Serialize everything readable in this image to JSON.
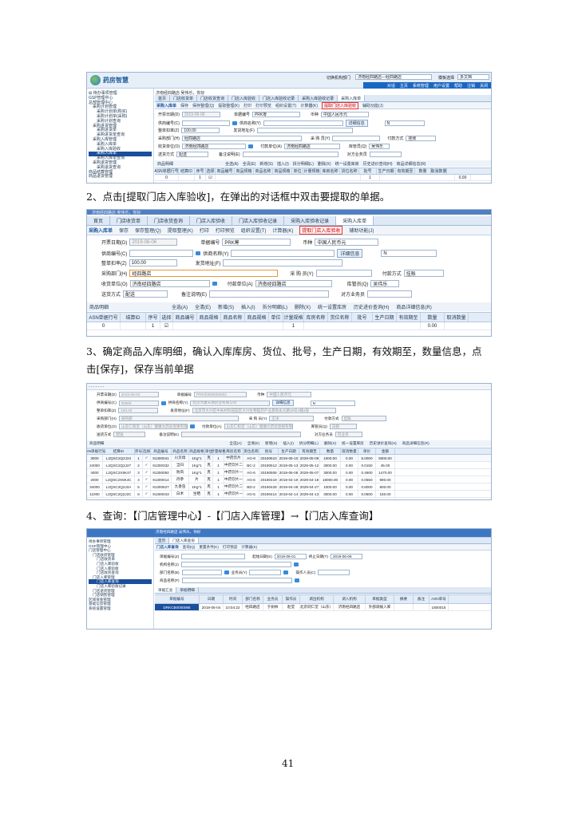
{
  "page_number": "41",
  "steps": {
    "step2": "2、点击[提取门店入库验收]，在弹出的对话框中双击要提取的单据。",
    "step3_line1": "3、确定商品入库明细，确认入库库房、货位、批号，生产日期，有效期至，数量信息，点",
    "step3_line2": "击[保存]，保存当前单据",
    "step4": "4、查询：【门店管理中心】-【门店入库管理】→【门店入库查询】"
  },
  "shot1": {
    "logo": "药房智慧",
    "user_line": "济南经四路店  吴伟乐，你好",
    "top_right": [
      "切换机构部门",
      "济南经四路店—经四路店",
      "模板选择",
      "多文档"
    ],
    "blue_nav": [
      "对话",
      "主页",
      "系统管理",
      "用户设置",
      "帮助",
      "注销",
      "关闭"
    ],
    "tabs": [
      "首页",
      "门店收货单",
      "门店收货查询",
      "门店入库验收",
      "门店入库验收记录",
      "采购入库验收记录",
      "采购入库单"
    ],
    "toolbar": [
      "采购入库单",
      "保存",
      "保存整理(Q)",
      "提取整理(K)",
      "打印",
      "打印预览",
      "组织设置(T)",
      "计算器(K)",
      "提取门店入库验收",
      "辅助功能(J)"
    ],
    "sidebar": [
      "待办事项管理",
      "GSP管理中心",
      "总部管理中心",
      "采购计划管理",
      "采购计划单(购买)",
      "采购计划单(采购)",
      "采购计划查询",
      "采购进货管理",
      "采购进货单",
      "采购进货单查询",
      "采购入库管理",
      "采购入库单",
      "采购入库验收",
      "采购入库单",
      "采购入库单查询",
      "采购退货管理",
      "采购退货查询",
      "商品结算管理",
      "商品退货管理"
    ],
    "form": {
      "open_date_label": "开票日期(D)",
      "open_date": "2019-06-06",
      "doc_no_label": "单据编号",
      "doc_no": "PRK筹",
      "currency_label": "币种",
      "currency": "中国人民币元",
      "supplier_no_label": "供商编号(C)",
      "supplier_name_label": "供商名称(Y)",
      "detail_btn": "详细信息",
      "n_field": "N",
      "discount_label": "整单扣率(Z)",
      "discount": "100.00",
      "ship_addr_label": "发货地址(F)",
      "buyer_dept_label": "采购部门(H)",
      "buyer_dept": "经四路店",
      "buyer_label": "采 购 员(Y)",
      "pay_label": "付款方式",
      "pay": "挂账",
      "recv_unit_label": "收货单位(O)",
      "recv_unit": "济南经四路店",
      "pay_unit_label": "付款单位(A)",
      "pay_unit": "济南经四路店",
      "warehouse_keeper_label": "库管员(Q)",
      "warehouse_keeper": "吴伟乐",
      "delivery_label": "送货方式",
      "delivery": "配送",
      "remark_label": "备注说明(E)",
      "salesman_label": "对方业务员"
    },
    "grid_tools": [
      "商品明细",
      "全选(A)",
      "全清(E)",
      "新增(S)",
      "插入(I)",
      "拆分明细(L)",
      "删除(X)",
      "统一设置库房",
      "历史进价查询(H)",
      "商品详细信息(R)"
    ],
    "grid_cols": [
      "ASN单据行号",
      "结算ID",
      "序号",
      "选择",
      "商品编号",
      "商品规格",
      "商品名称",
      "商品规格",
      "单位",
      "计量规格",
      "库房名称",
      "货位名称",
      "批号",
      "生产日期",
      "有效期至",
      "数量",
      "取消数量"
    ],
    "grid_row": {
      "asn": "0",
      "seq": "1",
      "spec": "1",
      "qty": "0.00"
    }
  },
  "shot2": {
    "user_line": "济南经四路店  吴伟乐，你好",
    "tabs": [
      "首页",
      "门店收货单",
      "门店收货查询",
      "门店入库验收",
      "门店入库验收记录",
      "采购入库验收记录",
      "采购入库单"
    ],
    "toolbar": [
      "采购入库单",
      "保存",
      "保存整理(Q)",
      "提取整理(K)",
      "打印",
      "打印预览",
      "组织设置(T)",
      "计算器(K)",
      "提取门店入库验收",
      "辅助功能(J)"
    ],
    "form": {
      "open_date_label": "开票日期(D)",
      "open_date": "2019-06-06",
      "doc_no_label": "单据编号",
      "doc_no": "PRK筹",
      "currency_label": "币种",
      "currency": "中国人民币元",
      "supplier_no_label": "供商编号(C)",
      "supplier_name_label": "供商名称(Y)",
      "detail_btn": "详细信息",
      "n_field": "N",
      "discount_label": "整单扣率(Z)",
      "discount": "100.00",
      "ship_addr_label": "发货地址(F)",
      "buyer_dept_label": "采购部门(H)",
      "buyer_dept": "经四路店",
      "buyer_label": "采 购 员(Y)",
      "pay_label": "付款方式",
      "pay": "挂账",
      "recv_unit_label": "收货单位(O)",
      "recv_unit": "济南经四路店",
      "pay_unit_label": "付款单位(A)",
      "pay_unit": "济南经四路店",
      "warehouse_keeper_label": "库管员(Q)",
      "warehouse_keeper": "吴伟乐",
      "delivery_label": "送货方式",
      "delivery": "配送",
      "remark_label": "备注说明(E)",
      "salesman_label": "对方业务员"
    },
    "grid_tools": [
      "商品明细",
      "全选(A)",
      "全清(E)",
      "新增(S)",
      "插入(I)",
      "拆分明细(L)",
      "删除(X)",
      "统一设置库房",
      "历史进价查询(H)",
      "商品详细信息(R)"
    ],
    "grid_cols": [
      "ASN单据行号",
      "结算ID",
      "序号",
      "选择",
      "商品编号",
      "商品规格",
      "商品名称",
      "商品规格",
      "单位",
      "计量规格",
      "库房名称",
      "货位名称",
      "批号",
      "生产日期",
      "有效期至",
      "数量",
      "取消数量"
    ],
    "grid_row": {
      "asn": "0",
      "seq": "1",
      "spec": "1",
      "qty": "0.00"
    }
  },
  "shot3": {
    "form": {
      "open_date_label": "开票日期(D)",
      "open_date": "2019-06-04",
      "doc_no_label": "单据编号",
      "doc_no": "PRK00000000003",
      "currency_label": "币种",
      "currency": "中国人民币元",
      "supplier_no_label": "供商编号(C)",
      "supplier_no": "00009",
      "supplier_name_label": "供商名称(Y)",
      "supplier_name": "北京大康天源药业有限公司",
      "detail_btn": "详细信息",
      "n_field": "N",
      "discount_label": "整单扣率(Z)",
      "discount": "100.00",
      "ship_addr_label": "发货地址(F)",
      "ship_addr": "北京市大兴区中关村科技园区大兴生物医药产业基地永大路38号4幢4层",
      "buyer_dept_label": "采购部门(H)",
      "buyer_dept": "采购部",
      "buyer_label": "采 购 员(Y)",
      "buyer": "王洋",
      "pay_label": "付款方式",
      "pay": "挂账",
      "recv_unit_label": "收货单位(O)",
      "recv_unit": "山东仁和堂（山东）健康大药房连锁有限公司",
      "pay_unit_label": "付款单位(A)",
      "pay_unit": "山东仁和堂（山东）健康大药房连锁有限公司",
      "warehouse_keeper_label": "库管员(Q)",
      "warehouse_keeper": "白鹤",
      "delivery_label": "送货方式",
      "delivery": "配送",
      "remark_label": "备注说明(E)",
      "salesman_label": "对方业务员",
      "salesman": "刘业务"
    },
    "grid_tools": [
      "商品明细",
      "全选(A)",
      "全清(E)",
      "新增(S)",
      "插入(I)",
      "拆分明细(L)",
      "删除(X)",
      "统一设置库房",
      "历史进价查询(H)",
      "商品详细信息(R)"
    ],
    "grid_cols": [
      "ASN单据行号",
      "结算ID",
      "序号",
      "选择",
      "商品编号",
      "商品名称",
      "商品规格",
      "单位",
      "计量规格",
      "库房名称",
      "货位名称",
      "批号",
      "生产日期",
      "有效期至",
      "数量",
      "取消数量",
      "单价",
      "金额"
    ],
    "rows": [
      [
        "3000",
        "L2QSC2Q2J24",
        "1",
        "✓",
        "91300041",
        "川贝母",
        "1Kg*1",
        "克",
        "1",
        "中药饮片",
        "AG-9",
        "20190510",
        "2019-05-10",
        "2029-05-09",
        "1000.00",
        "0.00",
        "5.0000",
        "5000.00"
      ],
      [
        "24000",
        "L2QSC2Q2J27",
        "2",
        "✓",
        "91300332",
        "当归",
        "1Kg*1",
        "克",
        "1",
        "中药饮片二",
        "BC-2",
        "20190513",
        "2019-05-13",
        "2029-05-12",
        "3000.00",
        "0.00",
        "0.0150",
        "45.00"
      ],
      [
        "4000",
        "L2QSC2X5K47",
        "3",
        "✓",
        "91300092",
        "防风",
        "1Kg*1",
        "克",
        "1",
        "中药饮片一",
        "AG-6",
        "20190508",
        "2019-05-08",
        "2029-05-07",
        "3000.00",
        "0.00",
        "0.4900",
        "1470.00"
      ],
      [
        "2000",
        "L2QSC2X5K4C",
        "4",
        "✓",
        "91300014",
        "丹参",
        "片",
        "克",
        "1",
        "中药饮片一",
        "AG-6",
        "20190419",
        "2019-04-19",
        "2029-04-18",
        "18000.00",
        "0.00",
        "0.0550",
        "990.00"
      ],
      [
        "34000",
        "L2QSC2Q2J2A",
        "5",
        "✓",
        "91300527",
        "九香虫",
        "1Kg*1",
        "克",
        "1",
        "中药饮片二",
        "BD-2",
        "20190428",
        "2019-04-28",
        "2029-04-27",
        "1000.00",
        "0.00",
        "0.8000",
        "800.00"
      ],
      [
        "11000",
        "L2QSC2Q2J2C",
        "6",
        "✓",
        "91300043",
        "白术",
        "生晒",
        "克",
        "1",
        "中药饮片一",
        "AG-5",
        "20190414",
        "2019-04-14",
        "2029-04-13",
        "3000.00",
        "0.00",
        "0.0500",
        "150.00"
      ]
    ]
  },
  "shot4": {
    "user_line": "济南经四路店  吴伟乐，你好",
    "tabs": [
      "首页",
      "门店入库查询"
    ],
    "toolbar": [
      "门店入库查询",
      "查询(Q)",
      "重置条件(K)",
      "打印预览",
      "计算器(K)"
    ],
    "sidebar": [
      "待办事项管理",
      "GSP管理中心",
      "门店管理中心",
      "门店收货管理",
      "门店收货单",
      "门店入库验收",
      "门店入库验收",
      "门店收货查询",
      "门店入库管理",
      "门店入库查询",
      "门店入库验收记录",
      "门店退货管理",
      "门店销售管理",
      "区域资金管理",
      "基础信息管理",
      "系统设置管理"
    ],
    "form": {
      "doc_no_label": "单据编号(Z)",
      "start_date_label": "起始日期(S)",
      "start_date": "2019-06-01",
      "end_date_label": "终止日期(T)",
      "end_date": "2019-06-06",
      "org_label": "机构名称(J)",
      "dept_label": "部门名称(B)",
      "salesman_label": "业务员(Y)",
      "operator_label": "操作人员(C)",
      "product_label": "商品名称(P)"
    },
    "sub_tabs": [
      "单据汇总",
      "单据明细"
    ],
    "grid_cols": [
      "单据编号",
      "日期",
      "时间",
      "部门名称",
      "业务员",
      "操作员",
      "调出机构",
      "调入机构",
      "单据类型",
      "摘要",
      "备注",
      "ASN单号"
    ],
    "row": [
      "DRKCB0000095",
      "2019-06-04",
      "10:04:22",
      "经四路店",
      "于树林",
      "赵莹",
      "北京同仁堂（山东）",
      "济南经四路店",
      "外部调拨入库",
      "",
      "",
      "1800015"
    ]
  }
}
